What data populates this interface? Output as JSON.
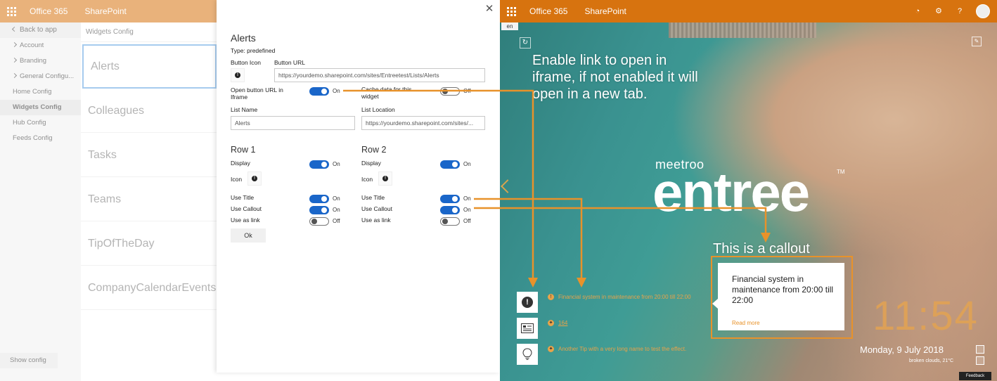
{
  "left_app": {
    "suite": {
      "office": "Office 365",
      "sharepoint": "SharePoint"
    },
    "nav": {
      "back": "Back to app",
      "account": "Account",
      "branding": "Branding",
      "general": "General Configu...",
      "home": "Home Config",
      "widgets": "Widgets Config",
      "hub": "Hub Config",
      "feeds": "Feeds Config"
    },
    "show_config": "Show config",
    "widgets_title": "Widgets Config",
    "widgets": [
      "Alerts",
      "Colleagues",
      "Tasks",
      "Teams",
      "TipOfTheDay",
      "CompanyCalendarEvents"
    ]
  },
  "panel": {
    "title": "Alerts",
    "type": "Type: predefined",
    "button_icon_label": "Button Icon",
    "button_url_label": "Button URL",
    "button_url_value": "https://yourdemo.sharepoint.com/sites/Entreetest/Lists/Alerts",
    "open_iframe_label": "Open button URL in Iframe",
    "open_iframe_state": "On",
    "cache_label": "Cache data for this widget",
    "cache_state": "Off",
    "list_name_label": "List Name",
    "list_name_value": "Alerts",
    "list_location_label": "List Location",
    "list_location_value": "https://yourdemo.sharepoint.com/sites/...",
    "row1": {
      "title": "Row 1",
      "display_label": "Display",
      "display_state": "On",
      "icon_label": "Icon",
      "use_title_label": "Use Title",
      "use_title_state": "On",
      "use_callout_label": "Use Callout",
      "use_callout_state": "On",
      "use_link_label": "Use as link",
      "use_link_state": "Off"
    },
    "row2": {
      "title": "Row 2",
      "display_label": "Display",
      "display_state": "On",
      "icon_label": "Icon",
      "use_title_label": "Use Title",
      "use_title_state": "On",
      "use_callout_label": "Use Callout",
      "use_callout_state": "On",
      "use_link_label": "Use as link",
      "use_link_state": "Off"
    },
    "ok": "Ok"
  },
  "preview": {
    "suite": {
      "office": "Office 365",
      "sharepoint": "SharePoint"
    },
    "lang": "en",
    "annotation_iframe": "Enable link to open in iframe, if not enabled it will open in a new tab.",
    "annotation_callout": "This is a callout",
    "logo_small": "meetroo",
    "logo_big": "entree",
    "logo_tm": "TM",
    "feed": {
      "alert": "Financial system in maintenance from 20:00 till 22:00",
      "news_count": "164",
      "tip": "Another Tip with a very long name to test the effect."
    },
    "callout": {
      "text": "Financial system in maintenance from 20:00 till 22:00",
      "link": "Read more"
    },
    "clock": "11:54",
    "date": "Monday, 9 July 2018",
    "weather": "broken clouds, 21°C",
    "feedback": "Feedback"
  },
  "colors": {
    "accent": "#d7730f",
    "annotation": "#e8922a",
    "toggle_on": "#1a66c9"
  }
}
